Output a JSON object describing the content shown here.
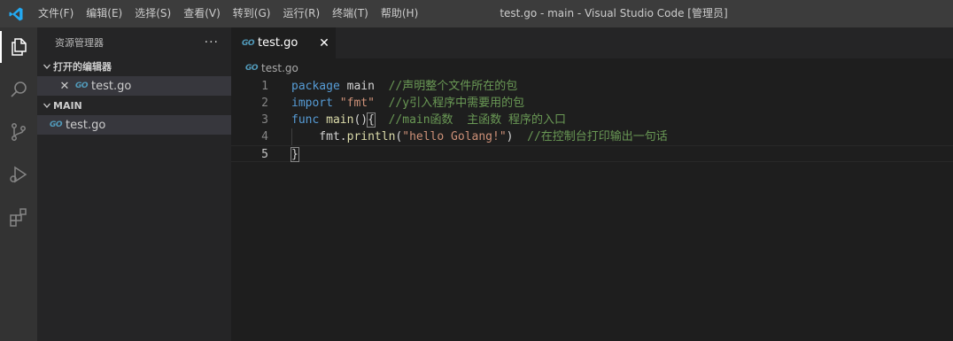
{
  "menu": [
    "文件(F)",
    "编辑(E)",
    "选择(S)",
    "查看(V)",
    "转到(G)",
    "运行(R)",
    "终端(T)",
    "帮助(H)"
  ],
  "window_title": "test.go - main - Visual Studio Code [管理员]",
  "sidebar": {
    "title": "资源管理器",
    "more": "···",
    "open_editors_label": "打开的编辑器",
    "open_editors": [
      {
        "badge": "GO",
        "name": "test.go"
      }
    ],
    "folder_label": "MAIN",
    "files": [
      {
        "badge": "GO",
        "name": "test.go"
      }
    ]
  },
  "tab": {
    "badge": "GO",
    "name": "test.go",
    "close": "✕"
  },
  "breadcrumb": {
    "badge": "GO",
    "name": "test.go"
  },
  "code_lines": [
    {
      "num": "1",
      "tokens": [
        [
          "kw",
          "package"
        ],
        [
          "plain",
          " main  "
        ],
        [
          "cm",
          "//声明整个文件所在的包"
        ]
      ]
    },
    {
      "num": "2",
      "tokens": [
        [
          "kw",
          "import"
        ],
        [
          "plain",
          " "
        ],
        [
          "str",
          "\"fmt\""
        ],
        [
          "plain",
          "  "
        ],
        [
          "cm",
          "//y引入程序中需要用的包"
        ]
      ]
    },
    {
      "num": "3",
      "tokens": [
        [
          "kw",
          "func"
        ],
        [
          "plain",
          " "
        ],
        [
          "fn",
          "main"
        ],
        [
          "plain",
          "()"
        ],
        [
          "br",
          "{"
        ],
        [
          "plain",
          "  "
        ],
        [
          "cm",
          "//main函数  主函数 程序的入口"
        ]
      ]
    },
    {
      "num": "4",
      "tokens": [
        [
          "plain",
          "    fmt."
        ],
        [
          "fn",
          "println"
        ],
        [
          "plain",
          "("
        ],
        [
          "str",
          "\"hello Golang!\""
        ],
        [
          "plain",
          ")  "
        ],
        [
          "cm",
          "//在控制台打印输出一句话"
        ]
      ]
    },
    {
      "num": "5",
      "tokens": [
        [
          "br",
          "}"
        ]
      ]
    }
  ],
  "active_line": 5,
  "colors": {
    "keyword": "#569cd6",
    "string": "#ce9178",
    "function": "#dcdcaa",
    "comment": "#6a9955",
    "go_icon": "#519aba",
    "vscode_logo": "#23a9f2"
  }
}
